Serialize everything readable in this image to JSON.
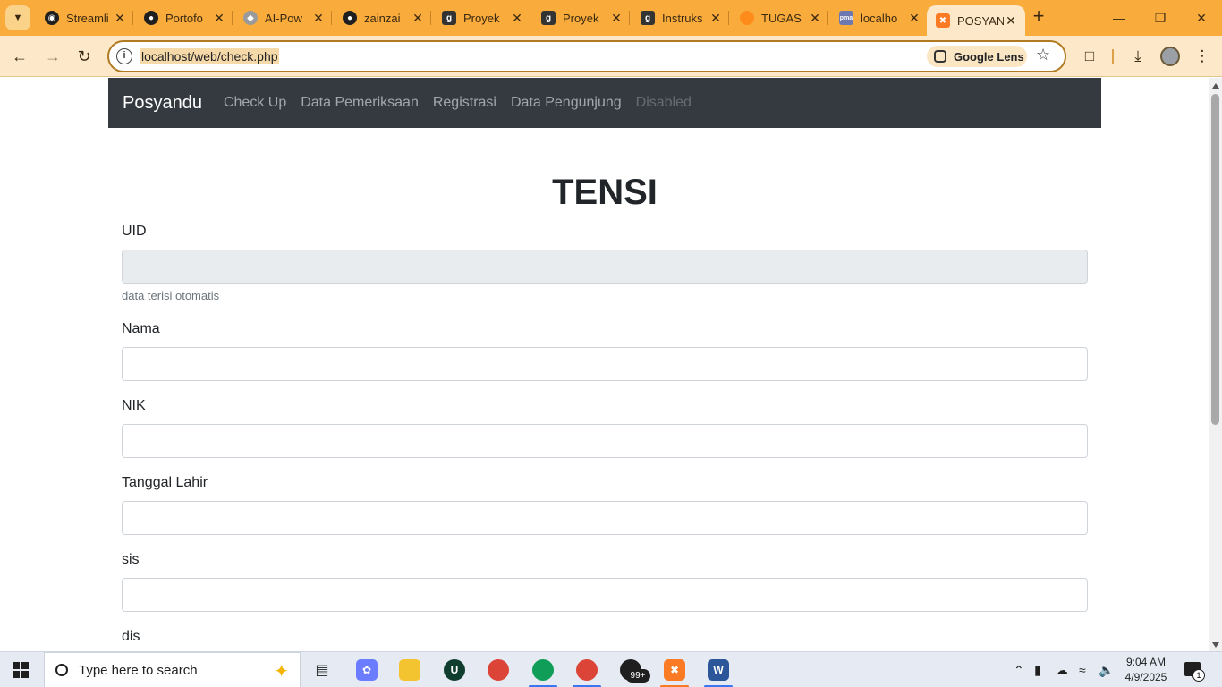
{
  "browser": {
    "tabs": [
      {
        "title": "Streamli",
        "favicon": "streamlit-icon",
        "color": "#1f1f1f"
      },
      {
        "title": "Portofo",
        "favicon": "github-icon",
        "color": "#1f1f1f"
      },
      {
        "title": "AI-Pow",
        "favicon": "layers-icon",
        "color": "#7a7a7a"
      },
      {
        "title": "zainzai",
        "favicon": "github-icon",
        "color": "#1f1f1f"
      },
      {
        "title": "Proyek",
        "favicon": "g-icon",
        "color": "#333333"
      },
      {
        "title": "Proyek",
        "favicon": "g-icon",
        "color": "#333333"
      },
      {
        "title": "Instruks",
        "favicon": "g-icon",
        "color": "#333333"
      },
      {
        "title": "TUGAS",
        "favicon": "orange-icon",
        "color": "#ff8c1a"
      },
      {
        "title": "localho",
        "favicon": "pma-icon",
        "color": "#6c78af"
      },
      {
        "title": "POSYAN",
        "favicon": "xampp-icon",
        "color": "#fb7a24"
      }
    ],
    "address": {
      "url": "localhost/web/check.php",
      "lens_label": "Google Lens"
    }
  },
  "page": {
    "brand": "Posyandu",
    "nav": [
      "Check Up",
      "Data Pemeriksaan",
      "Registrasi",
      "Data Pengunjung"
    ],
    "nav_disabled": "Disabled",
    "title": "TENSI",
    "fields": {
      "uid_label": "UID",
      "uid_help": "data terisi otomatis",
      "nama_label": "Nama",
      "nik_label": "NIK",
      "tgl_label": "Tanggal Lahir",
      "sis_label": "sis",
      "dis_label": "dis"
    }
  },
  "taskbar": {
    "search_placeholder": "Type here to search",
    "whatsapp_badge": "99+",
    "time": "9:04 AM",
    "date": "4/9/2025",
    "notifications": "1"
  }
}
